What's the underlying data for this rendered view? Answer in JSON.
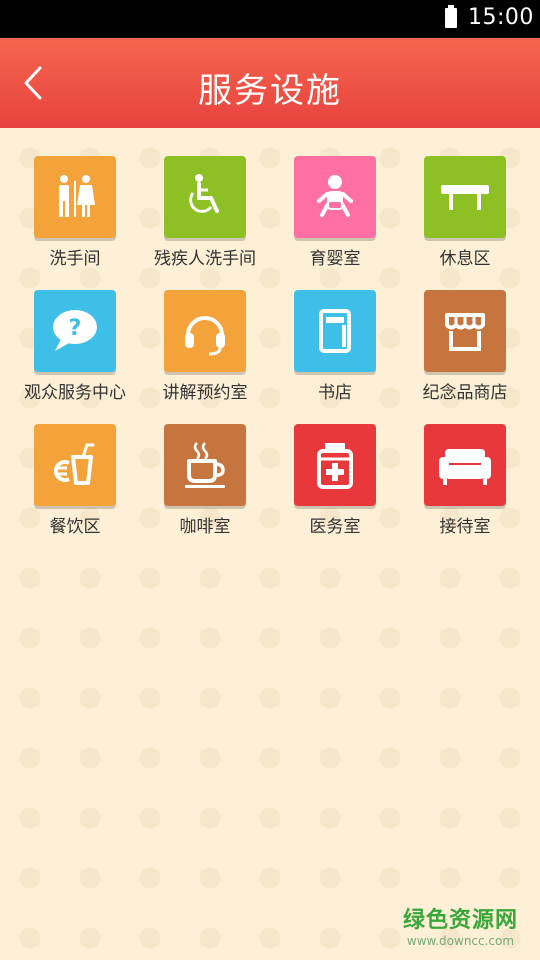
{
  "status_bar": {
    "time": "15:00"
  },
  "header": {
    "title": "服务设施"
  },
  "facilities": [
    {
      "label": "洗手间",
      "icon": "restroom-icon",
      "color": "#f4a23a"
    },
    {
      "label": "残疾人洗手间",
      "icon": "wheelchair-icon",
      "color": "#8cc025"
    },
    {
      "label": "育婴室",
      "icon": "baby-icon",
      "color": "#ff6fa3"
    },
    {
      "label": "休息区",
      "icon": "bench-icon",
      "color": "#8cc025"
    },
    {
      "label": "观众服务中心",
      "icon": "help-bubble-icon",
      "color": "#3ebfe8"
    },
    {
      "label": "讲解预约室",
      "icon": "headset-icon",
      "color": "#f4a23a"
    },
    {
      "label": "书店",
      "icon": "book-icon",
      "color": "#3ebfe8"
    },
    {
      "label": "纪念品商店",
      "icon": "shop-icon",
      "color": "#c7753f"
    },
    {
      "label": "餐饮区",
      "icon": "drink-icon",
      "color": "#f4a23a"
    },
    {
      "label": "咖啡室",
      "icon": "coffee-icon",
      "color": "#c7753f"
    },
    {
      "label": "医务室",
      "icon": "medicine-icon",
      "color": "#e8383c"
    },
    {
      "label": "接待室",
      "icon": "sofa-icon",
      "color": "#e8383c"
    }
  ],
  "watermark": {
    "main": "绿色资源网",
    "sub": "www.downcc.com"
  }
}
